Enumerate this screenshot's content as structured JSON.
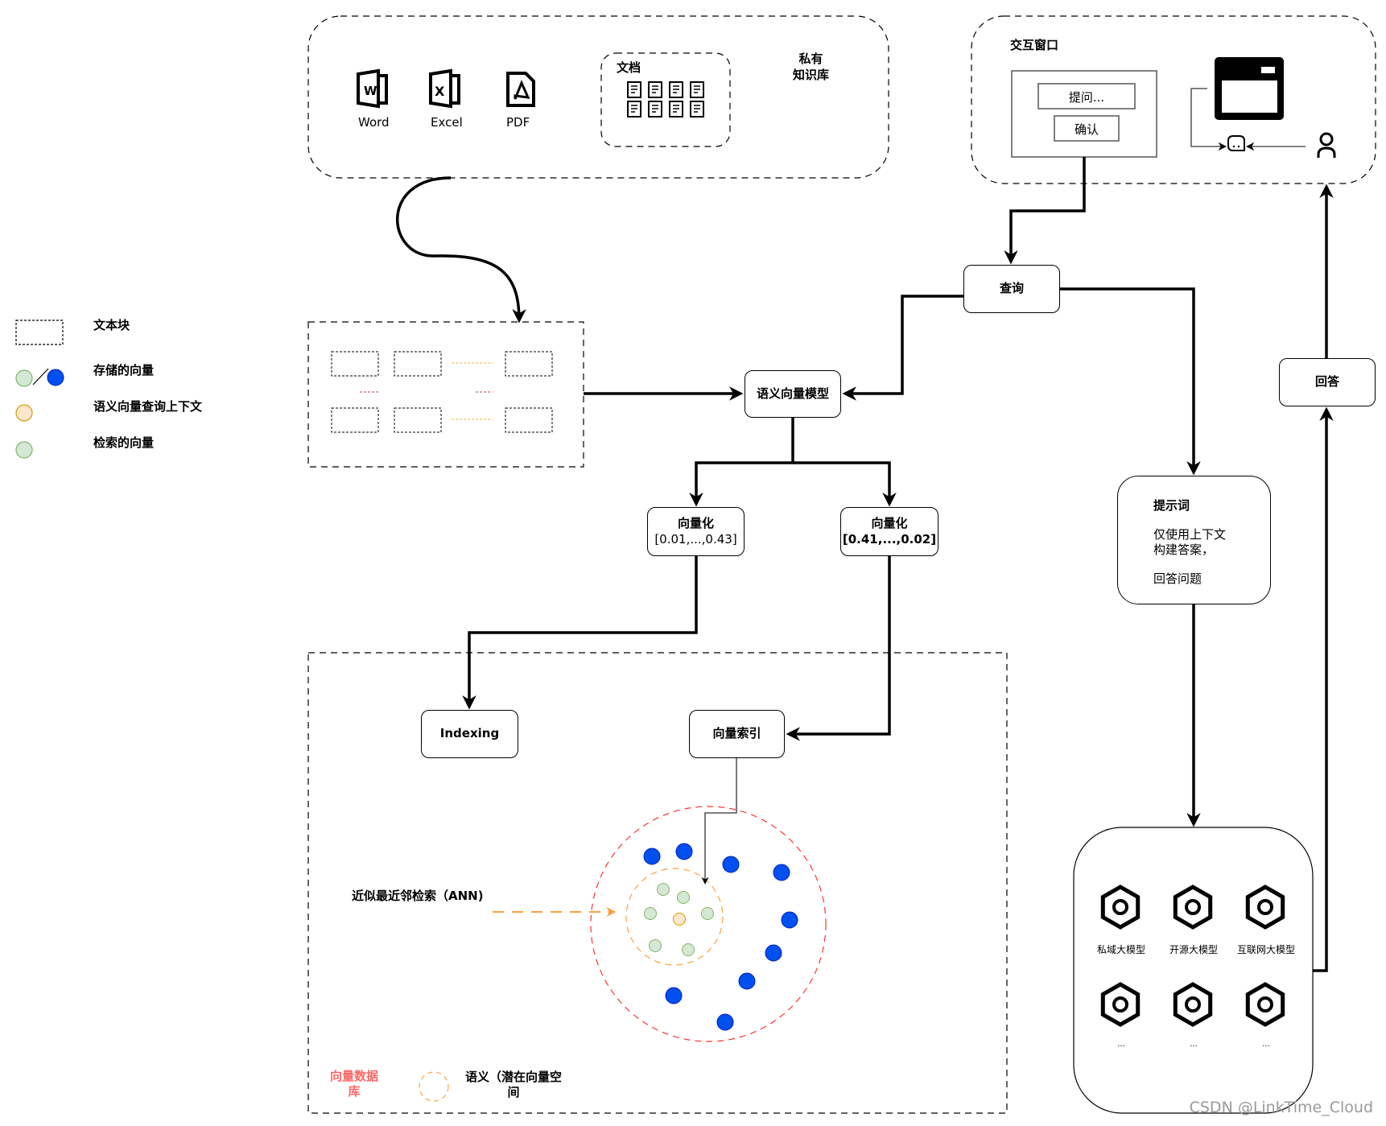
{
  "knowledge_base": {
    "title": "私有\n知识库",
    "files": [
      {
        "icon": "word-file-icon",
        "label": "Word"
      },
      {
        "icon": "excel-file-icon",
        "label": "Excel"
      },
      {
        "icon": "pdf-file-icon",
        "label": "PDF"
      }
    ],
    "docs_group_label": "文档"
  },
  "interaction": {
    "title": "交互窗口",
    "ask_placeholder": "提问...",
    "confirm_label": "确认"
  },
  "legend": {
    "items": [
      {
        "label": "文本块"
      },
      {
        "label": "存储的向量"
      },
      {
        "label": "语义向量查询上下文"
      },
      {
        "label": "检索的向量"
      }
    ]
  },
  "nodes": {
    "query": "查询",
    "semantic_model": "语义向量模型",
    "vectorize_left_title": "向量化",
    "vectorize_left_value": "[0.01,...,0.43]",
    "vectorize_right_title": "向量化",
    "vectorize_right_value": "[0.41,...,0.02]",
    "prompt_title": "提示词",
    "prompt_line1": "仅使用上下文",
    "prompt_line2": "构建答案，",
    "prompt_line3": "回答问题",
    "answer": "回答",
    "indexing": "Indexing",
    "vector_index": "向量索引"
  },
  "vector_db": {
    "ann_label": "近似最近邻检索（ANN)",
    "db_label": "向量数据\n库",
    "semantic_space_label": "语义（潜在向量空\n间"
  },
  "llms": [
    {
      "label": "私域大模型"
    },
    {
      "label": "开源大模型"
    },
    {
      "label": "互联网大模型"
    },
    {
      "label": "..."
    },
    {
      "label": "..."
    },
    {
      "label": "..."
    }
  ],
  "colors": {
    "stored_vector_blue": "#0050ef",
    "retrieved_green_fill": "#d5e8d4",
    "retrieved_green_stroke": "#82b366",
    "query_orange_fill": "#ffe6cc",
    "query_orange_stroke": "#d79b00",
    "db_label_red": "#ff6666",
    "ann_orange": "#ffa040",
    "db_circle_red": "#ff3333"
  },
  "watermark": "CSDN @LinkTime_Cloud"
}
